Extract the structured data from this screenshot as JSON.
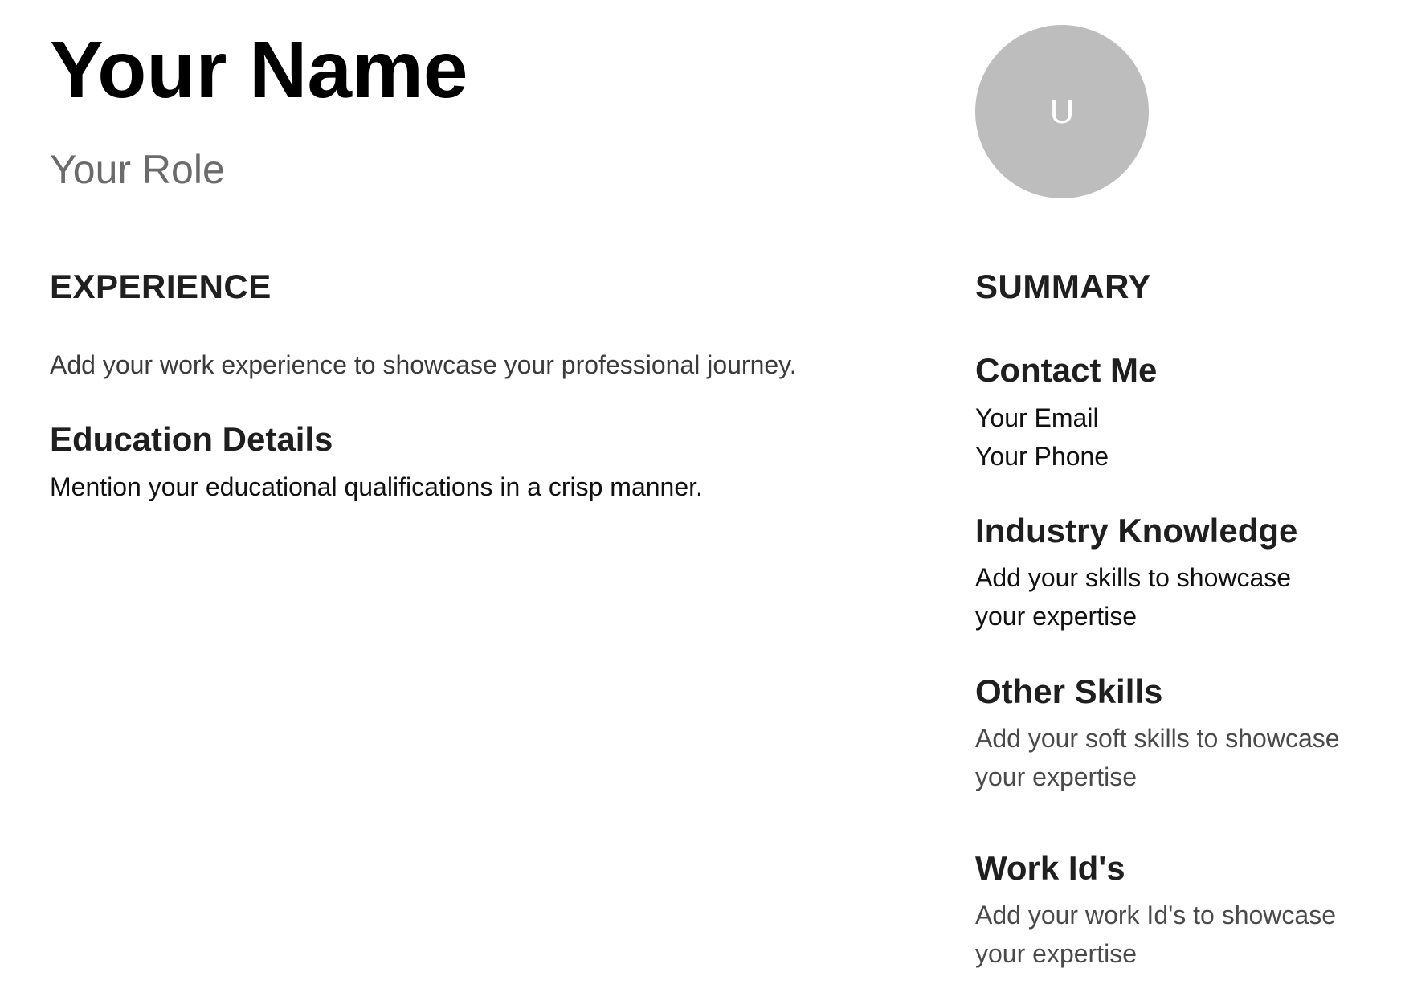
{
  "header": {
    "name": "Your Name",
    "role": "Your Role",
    "avatar_initial": "U"
  },
  "experience": {
    "heading": "EXPERIENCE",
    "text": "Add your work experience to showcase your professional journey."
  },
  "education": {
    "title": "Education Details",
    "text": "Mention your educational qualifications in a crisp manner."
  },
  "summary": {
    "heading": "SUMMARY",
    "contact": {
      "title": "Contact Me",
      "email": "Your Email",
      "phone": "Your Phone"
    },
    "industry_knowledge": {
      "title": "Industry Knowledge",
      "text": "Add your skills to showcase your expertise"
    },
    "other_skills": {
      "title": "Other Skills",
      "text": "Add your soft skills to showcase your expertise"
    },
    "work_ids": {
      "title": "Work Id's",
      "text": "Add your work Id's to showcase your expertise"
    }
  },
  "colors": {
    "avatar_bg": "#bdbdbd",
    "role_text": "#6b6b6b"
  }
}
